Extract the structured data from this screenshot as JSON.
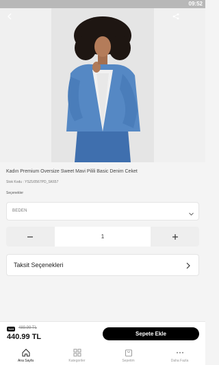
{
  "status_bar": {
    "time": "09:52"
  },
  "product": {
    "title": "Kadın Premium Oversize Sweet Mavi Pilili Basic Denim Ceket",
    "sku": "Stok Kodu : YSZU0567PD_SK657",
    "options_label": "Seçenekler",
    "size_select": {
      "value": "BEDEN"
    },
    "quantity": "1",
    "installment_label": "Taksit Seçenekleri"
  },
  "pricing": {
    "discount_badge": "%10",
    "old_price": "489.99 TL",
    "price": "440.99 TL",
    "add_to_cart": "Sepete Ekle"
  },
  "tabs": [
    {
      "label": "Ana Sayfa",
      "icon": "home-icon",
      "active": true
    },
    {
      "label": "Kategoriler",
      "icon": "grid-icon",
      "active": false
    },
    {
      "label": "Sepetim",
      "icon": "basket-icon",
      "active": false
    },
    {
      "label": "Daha Fazla",
      "icon": "more-icon",
      "active": false
    }
  ],
  "colors": {
    "accent": "#000000",
    "background": "#f4f4f4"
  }
}
